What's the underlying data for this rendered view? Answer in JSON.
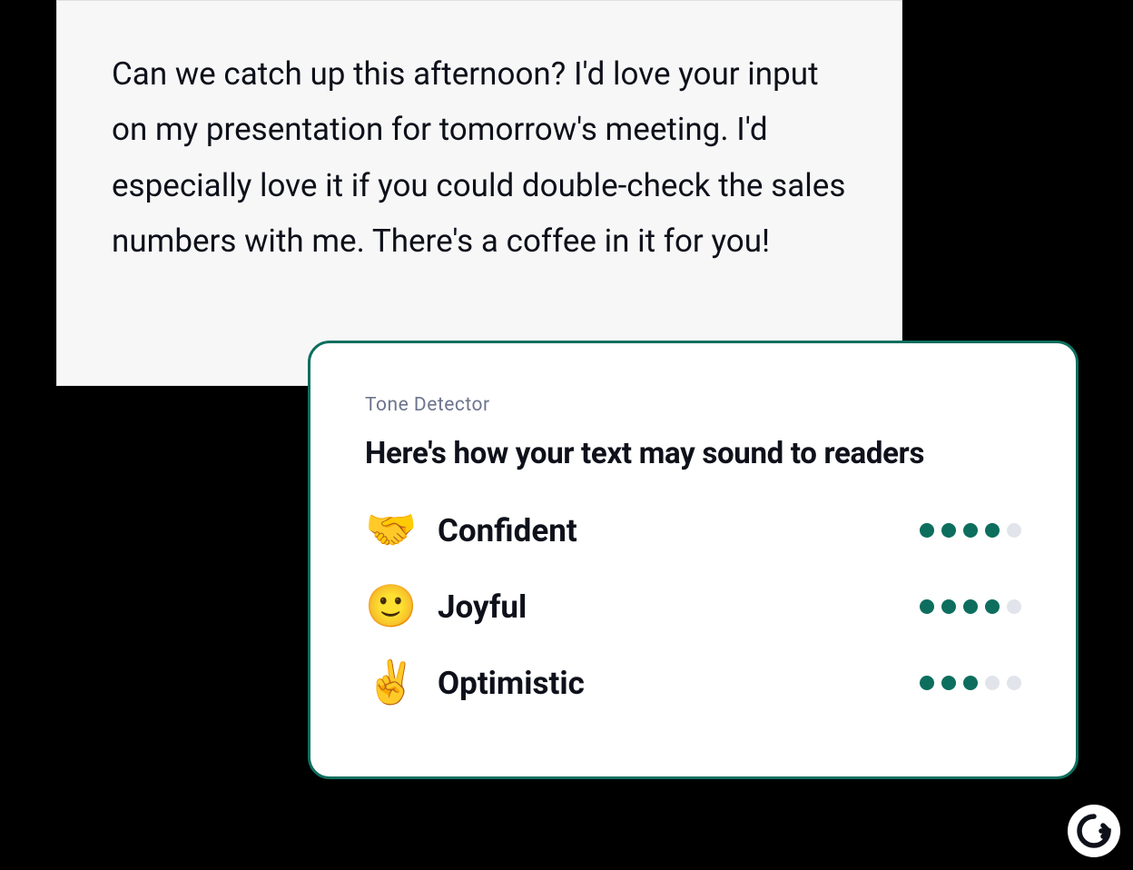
{
  "editor": {
    "text": "Can we catch up this afternoon? I'd love your input on my presentation for tomorrow's meeting. I'd especially love it if you could double-check the sales numbers with me. There's a coffee in it for you!"
  },
  "tone_panel": {
    "subtitle": "Tone Detector",
    "title": "Here's how your text may sound to readers",
    "tones": [
      {
        "emoji": "🤝",
        "label": "Confident",
        "score": 4,
        "max": 5
      },
      {
        "emoji": "🙂",
        "label": "Joyful",
        "score": 4,
        "max": 5
      },
      {
        "emoji": "✌️",
        "label": "Optimistic",
        "score": 3,
        "max": 5
      }
    ]
  },
  "colors": {
    "accent": "#0d6e5e",
    "text": "#0e101a",
    "muted": "#6d758d",
    "editor_bg": "#f7f7f7"
  }
}
